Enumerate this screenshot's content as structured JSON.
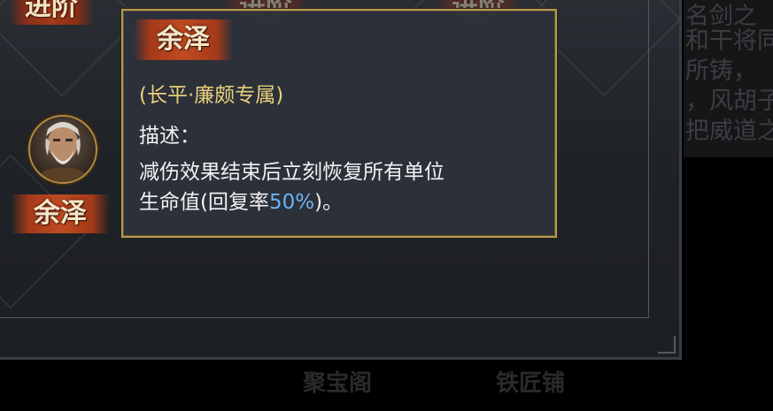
{
  "top_labels": [
    "进阶",
    "进阶",
    "进阶"
  ],
  "hero": {
    "name": "余泽",
    "avatar_icon": "old-general-portrait"
  },
  "story_text": [
    "名剑之",
    "和干将同",
    "所铸，",
    "，风胡子",
    "把威道之"
  ],
  "bottom_tabs": [
    "聚宝阁",
    "铁匠铺"
  ],
  "tooltip": {
    "title": "余泽",
    "subtitle": "(长平·廉颇专属)",
    "desc_label": "描述：",
    "desc_line1": "减伤效果结束后立刻恢复所有单位",
    "desc_line2_prefix": "生命值(回复率",
    "desc_line2_value": "50%",
    "desc_line2_suffix": ")。",
    "highlight_color": "#6fb3f2",
    "subtitle_color": "#e9cf7c"
  }
}
